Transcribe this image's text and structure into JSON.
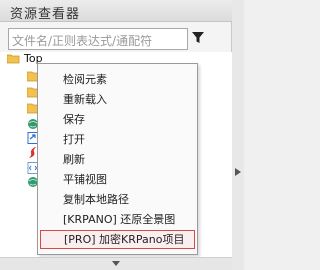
{
  "panel": {
    "title": "资源查看器"
  },
  "search": {
    "placeholder": "文件名/正则表达式/通配符"
  },
  "icons": {
    "filter": "filter-icon",
    "folder": "folder-icon",
    "globe": "globe-icon",
    "flash": "flash-icon",
    "scroll_right": "chevron-right-icon",
    "scroll_down": "chevron-down-icon"
  },
  "tree": {
    "root_label": "Top"
  },
  "context_menu": {
    "items": [
      {
        "label": "检阅元素"
      },
      {
        "label": "重新载入"
      },
      {
        "label": "保存"
      },
      {
        "label": "打开"
      },
      {
        "label": "刷新"
      },
      {
        "label": "平铺视图"
      },
      {
        "label": "复制本地路径"
      },
      {
        "label": "[KRPANO] 还原全景图"
      },
      {
        "label": "[PRO] 加密KRPano项目"
      }
    ],
    "highlighted_index": 8,
    "highlight_color": "#d64a4a"
  },
  "colors": {
    "folder": "#f2c14e",
    "folder_edge": "#c9962a",
    "globe": "#2f9b6e",
    "flash": "#d9342b",
    "link_blue": "#2f6fd6"
  }
}
